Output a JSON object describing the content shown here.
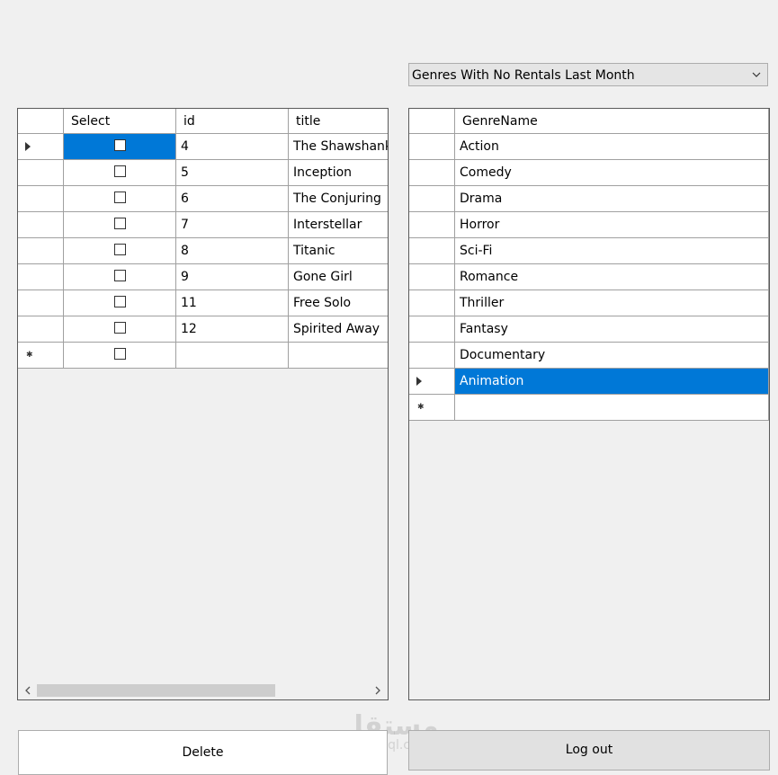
{
  "combo": {
    "selected": "Genres With No Rentals Last Month"
  },
  "left_grid": {
    "columns": [
      "",
      "Select",
      "id",
      "title"
    ],
    "rows": [
      {
        "id": "4",
        "title": "The Shawshank Redemption"
      },
      {
        "id": "5",
        "title": "Inception"
      },
      {
        "id": "6",
        "title": "The Conjuring"
      },
      {
        "id": "7",
        "title": "Interstellar"
      },
      {
        "id": "8",
        "title": "Titanic"
      },
      {
        "id": "9",
        "title": "Gone Girl"
      },
      {
        "id": "11",
        "title": "Free Solo"
      },
      {
        "id": "12",
        "title": "Spirited Away"
      }
    ]
  },
  "right_grid": {
    "columns": [
      "",
      "GenreName"
    ],
    "rows": [
      "Action",
      "Comedy",
      "Drama",
      "Horror",
      "Sci-Fi",
      "Romance",
      "Thriller",
      "Fantasy",
      "Documentary",
      "Animation"
    ]
  },
  "buttons": {
    "delete": "Delete",
    "logout": "Log out"
  },
  "watermark": {
    "logo": "مستقل",
    "url": "mostaql.com"
  },
  "colors": {
    "selection": "#0078d7",
    "background": "#f0f0f0"
  }
}
